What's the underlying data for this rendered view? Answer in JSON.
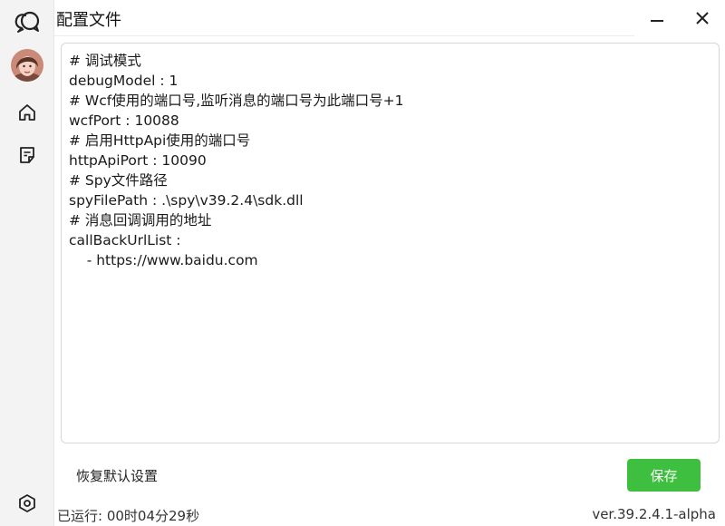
{
  "app": {
    "title": "配置文件"
  },
  "sidebar": {
    "icons": [
      "chat-bubbles-logo-icon",
      "avatar",
      "home-icon",
      "note-icon",
      "settings-icon"
    ]
  },
  "editor": {
    "lines": [
      "# 调试模式",
      "debugModel : 1",
      "# Wcf使用的端口号,监听消息的端口号为此端口号+1",
      "wcfPort : 10088",
      "# 启用HttpApi使用的端口号",
      "httpApiPort : 10090",
      "# Spy文件路径",
      "spyFilePath : .\\spy\\v39.2.4\\sdk.dll",
      "# 消息回调调用的地址",
      "callBackUrlList :",
      "    - https://www.baidu.com"
    ]
  },
  "actions": {
    "reset_label": "恢复默认设置",
    "save_label": "保存"
  },
  "footer": {
    "runtime": "已运行:  00时04分29秒",
    "version": "ver.39.2.4.1-alpha"
  },
  "colors": {
    "save_button": "#3fbf3f",
    "sidebar_bg": "#f3f3f3"
  }
}
